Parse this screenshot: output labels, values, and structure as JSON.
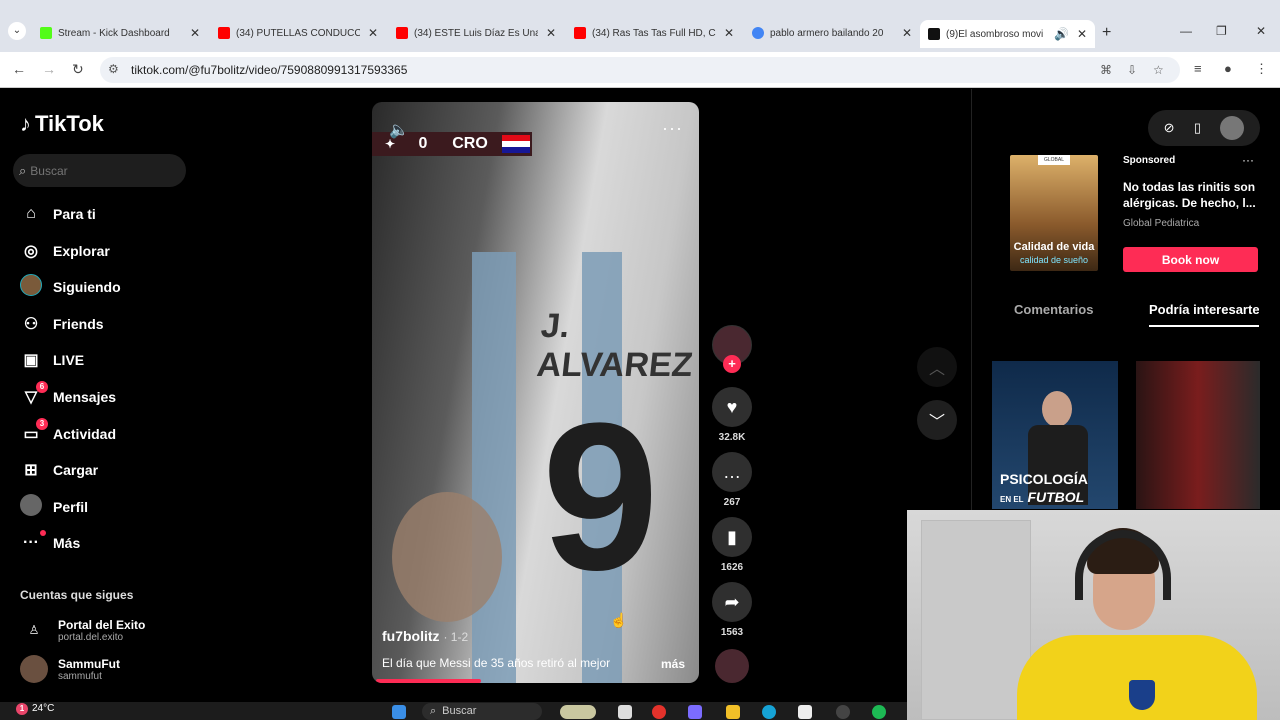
{
  "browser": {
    "tabs": [
      {
        "title": "Stream - Kick Dashboard",
        "favicon_color": "#53fc18",
        "active": false
      },
      {
        "title": "(34) PUTELLAS CONDUCCI",
        "favicon_color": "#ff0000",
        "active": false
      },
      {
        "title": "(34) ESTE Luis Díaz Es Una",
        "favicon_color": "#ff0000",
        "active": false
      },
      {
        "title": "(34) Ras Tas Tas Full HD, Ca",
        "favicon_color": "#ff0000",
        "active": false
      },
      {
        "title": "pablo armero bailando 20",
        "favicon_color": "#4285f4",
        "active": false
      },
      {
        "title": "(9)El asombroso movi",
        "favicon_color": "#111111",
        "active": true
      }
    ],
    "url": "tiktok.com/@fu7bolitz/video/7590880991317593365"
  },
  "tiktok": {
    "logo_text": "TikTok",
    "search_placeholder": "Buscar",
    "nav": [
      {
        "label": "Para ti",
        "icon": "home-icon"
      },
      {
        "label": "Explorar",
        "icon": "compass-icon"
      },
      {
        "label": "Siguiendo",
        "icon": "following-avatar"
      },
      {
        "label": "Friends",
        "icon": "friends-icon"
      },
      {
        "label": "LIVE",
        "icon": "live-icon"
      },
      {
        "label": "Mensajes",
        "icon": "messages-icon",
        "badge": "6"
      },
      {
        "label": "Actividad",
        "icon": "activity-icon",
        "badge": "3"
      },
      {
        "label": "Cargar",
        "icon": "upload-icon"
      },
      {
        "label": "Perfil",
        "icon": "profile-avatar"
      },
      {
        "label": "Más",
        "icon": "more-icon"
      }
    ],
    "following_heading": "Cuentas que sigues",
    "following": [
      {
        "name": "Portal del Exito",
        "handle": "portal.del.exito"
      },
      {
        "name": "SammuFut",
        "handle": "sammufut"
      }
    ],
    "video": {
      "scoreboard_score": "0",
      "scoreboard_team": "CRO",
      "jersey_name": "J. ALVAREZ",
      "jersey_number": "9",
      "username": "fu7bolitz",
      "date": "· 1-2",
      "description": "El día que Messi de 35 años retiró al mejor",
      "more": "más",
      "progress_fraction": 0.33
    },
    "actions": {
      "likes": "32.8K",
      "comments": "267",
      "saves": "1626",
      "shares": "1563"
    },
    "right_panel": {
      "ad": {
        "sponsored": "Sponsored",
        "text": "No todas las rinitis son alérgicas. De hecho, l...",
        "brand": "Global Pediatrica",
        "button": "Book now",
        "image_caption_1": "Calidad de vida",
        "image_caption_2": "calidad de sueño",
        "image_brand": "GLOBAL"
      },
      "tabs": [
        "Comentarios",
        "Podría interesarte"
      ],
      "thumb1_text_1": "PSICOLOGÍA",
      "thumb1_text_2_small": "EN EL",
      "thumb1_text_2": "FUTBOL"
    }
  },
  "taskbar": {
    "weather_badge": "1",
    "temperature": "24°C",
    "search_label": "Buscar"
  },
  "colors": {
    "accent": "#fe2c55",
    "background": "#000000"
  }
}
